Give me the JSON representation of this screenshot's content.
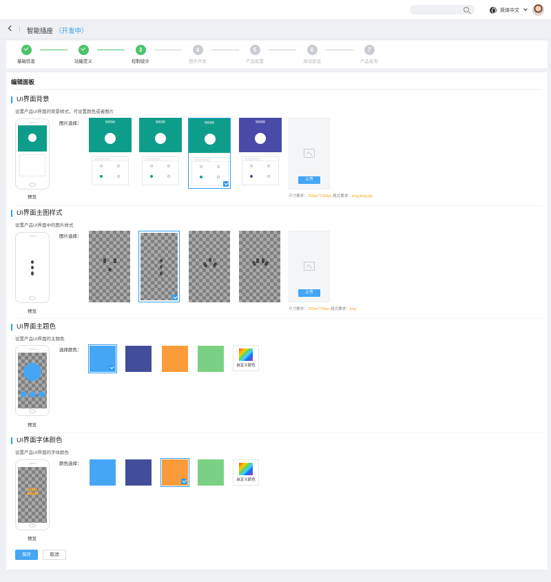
{
  "topbar": {
    "search_placeholder": "",
    "language": "简体中文",
    "language_icon": "globe-icon",
    "user_icon": "avatar"
  },
  "header": {
    "title": "智能插座",
    "status": "（开发中）"
  },
  "steps": [
    {
      "num": "1",
      "label": "基础信息",
      "state": "done"
    },
    {
      "num": "2",
      "label": "功能定义",
      "state": "done"
    },
    {
      "num": "3",
      "label": "控制设计",
      "state": "current"
    },
    {
      "num": "4",
      "label": "固件开发",
      "state": "todo"
    },
    {
      "num": "5",
      "label": "产品配置",
      "state": "todo"
    },
    {
      "num": "6",
      "label": "测试验证",
      "state": "todo"
    },
    {
      "num": "7",
      "label": "产品发布",
      "state": "todo"
    }
  ],
  "colors": {
    "accent": "#2f9cf0",
    "done": "#4cc36a",
    "todo": "#c9ccd2",
    "teal": "#0f9d8b",
    "purple": "#4a4aa8",
    "orange": "#f5a623"
  },
  "main": {
    "title": "编辑面板",
    "preview_label": "预览",
    "upload_label": "上传",
    "save_label": "保存",
    "cancel_label": "取消",
    "custom_color_label": "自定义颜色"
  },
  "sections": {
    "bg": {
      "title": "UI界面背景",
      "desc": "设置产品UI界面的背景样式，可设置颜色或者图片",
      "select_label": "图片选择：",
      "hint_prefix": "尺寸要求：",
      "hint_size": "750px*1334px",
      "hint_mid": ",格式要求：",
      "hint_format": "png,jpeg,jpg",
      "thumb_title": "智能插座",
      "thumbs": [
        {
          "color": "#0f9d8b",
          "selected": false
        },
        {
          "color": "#0f9d8b",
          "selected": false
        },
        {
          "color": "#0f9d8b",
          "selected": true
        },
        {
          "color": "#4a4aa8",
          "selected": false
        }
      ]
    },
    "main_img": {
      "title": "UI界面主图样式",
      "desc": "设置产品UI界面中的图片样式",
      "select_label": "图片选择：",
      "hint_prefix": "尺寸要求：",
      "hint_size": "720px*720px",
      "hint_mid": ",格式要求：",
      "hint_format": "png",
      "thumbs": [
        {
          "selected": false
        },
        {
          "selected": true
        },
        {
          "selected": false
        },
        {
          "selected": false
        }
      ]
    },
    "theme": {
      "title": "UI界面主题色",
      "desc": "设置产品UI界面的主题色",
      "select_label": "选择颜色：",
      "swatches": [
        {
          "color": "#44a6f5",
          "selected": true
        },
        {
          "color": "#434e9b",
          "selected": false
        },
        {
          "color": "#fc9b3a",
          "selected": false
        },
        {
          "color": "#7bd183",
          "selected": false
        }
      ]
    },
    "font": {
      "title": "UI界面字体颜色",
      "desc": "设置产品UI界面的字体颜色",
      "select_label": "颜色选择：",
      "swatches": [
        {
          "color": "#44a6f5",
          "selected": false
        },
        {
          "color": "#434e9b",
          "selected": false
        },
        {
          "color": "#fc9b3a",
          "selected": true
        },
        {
          "color": "#7bd183",
          "selected": false
        }
      ]
    }
  }
}
